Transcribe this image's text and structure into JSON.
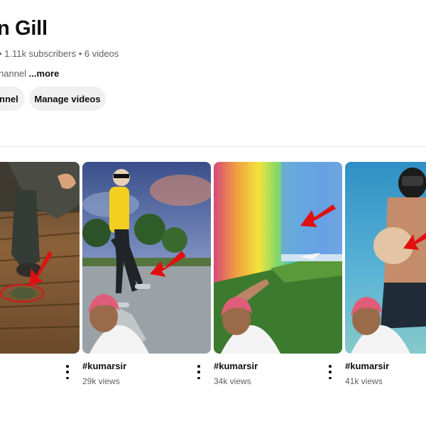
{
  "channel": {
    "name": "n Gill",
    "meta": "• 1.11k subscribers • 6 videos",
    "description": "hannel",
    "more_label": "...more",
    "customize_label": "nnel",
    "manage_label": "Manage videos"
  },
  "videos": [
    {
      "title": "",
      "views": ""
    },
    {
      "title": "#kumarsir",
      "views": "29k views"
    },
    {
      "title": "#kumarsir",
      "views": "34k views"
    },
    {
      "title": "#kumarsir",
      "views": "41k views"
    }
  ],
  "icons": {
    "more_actions": "vertical-dots-icon",
    "arrow": "red-arrow-icon"
  },
  "colors": {
    "arrow_red": "#e01010",
    "button_bg": "#f0f0f0",
    "secondary_text": "#606060"
  }
}
